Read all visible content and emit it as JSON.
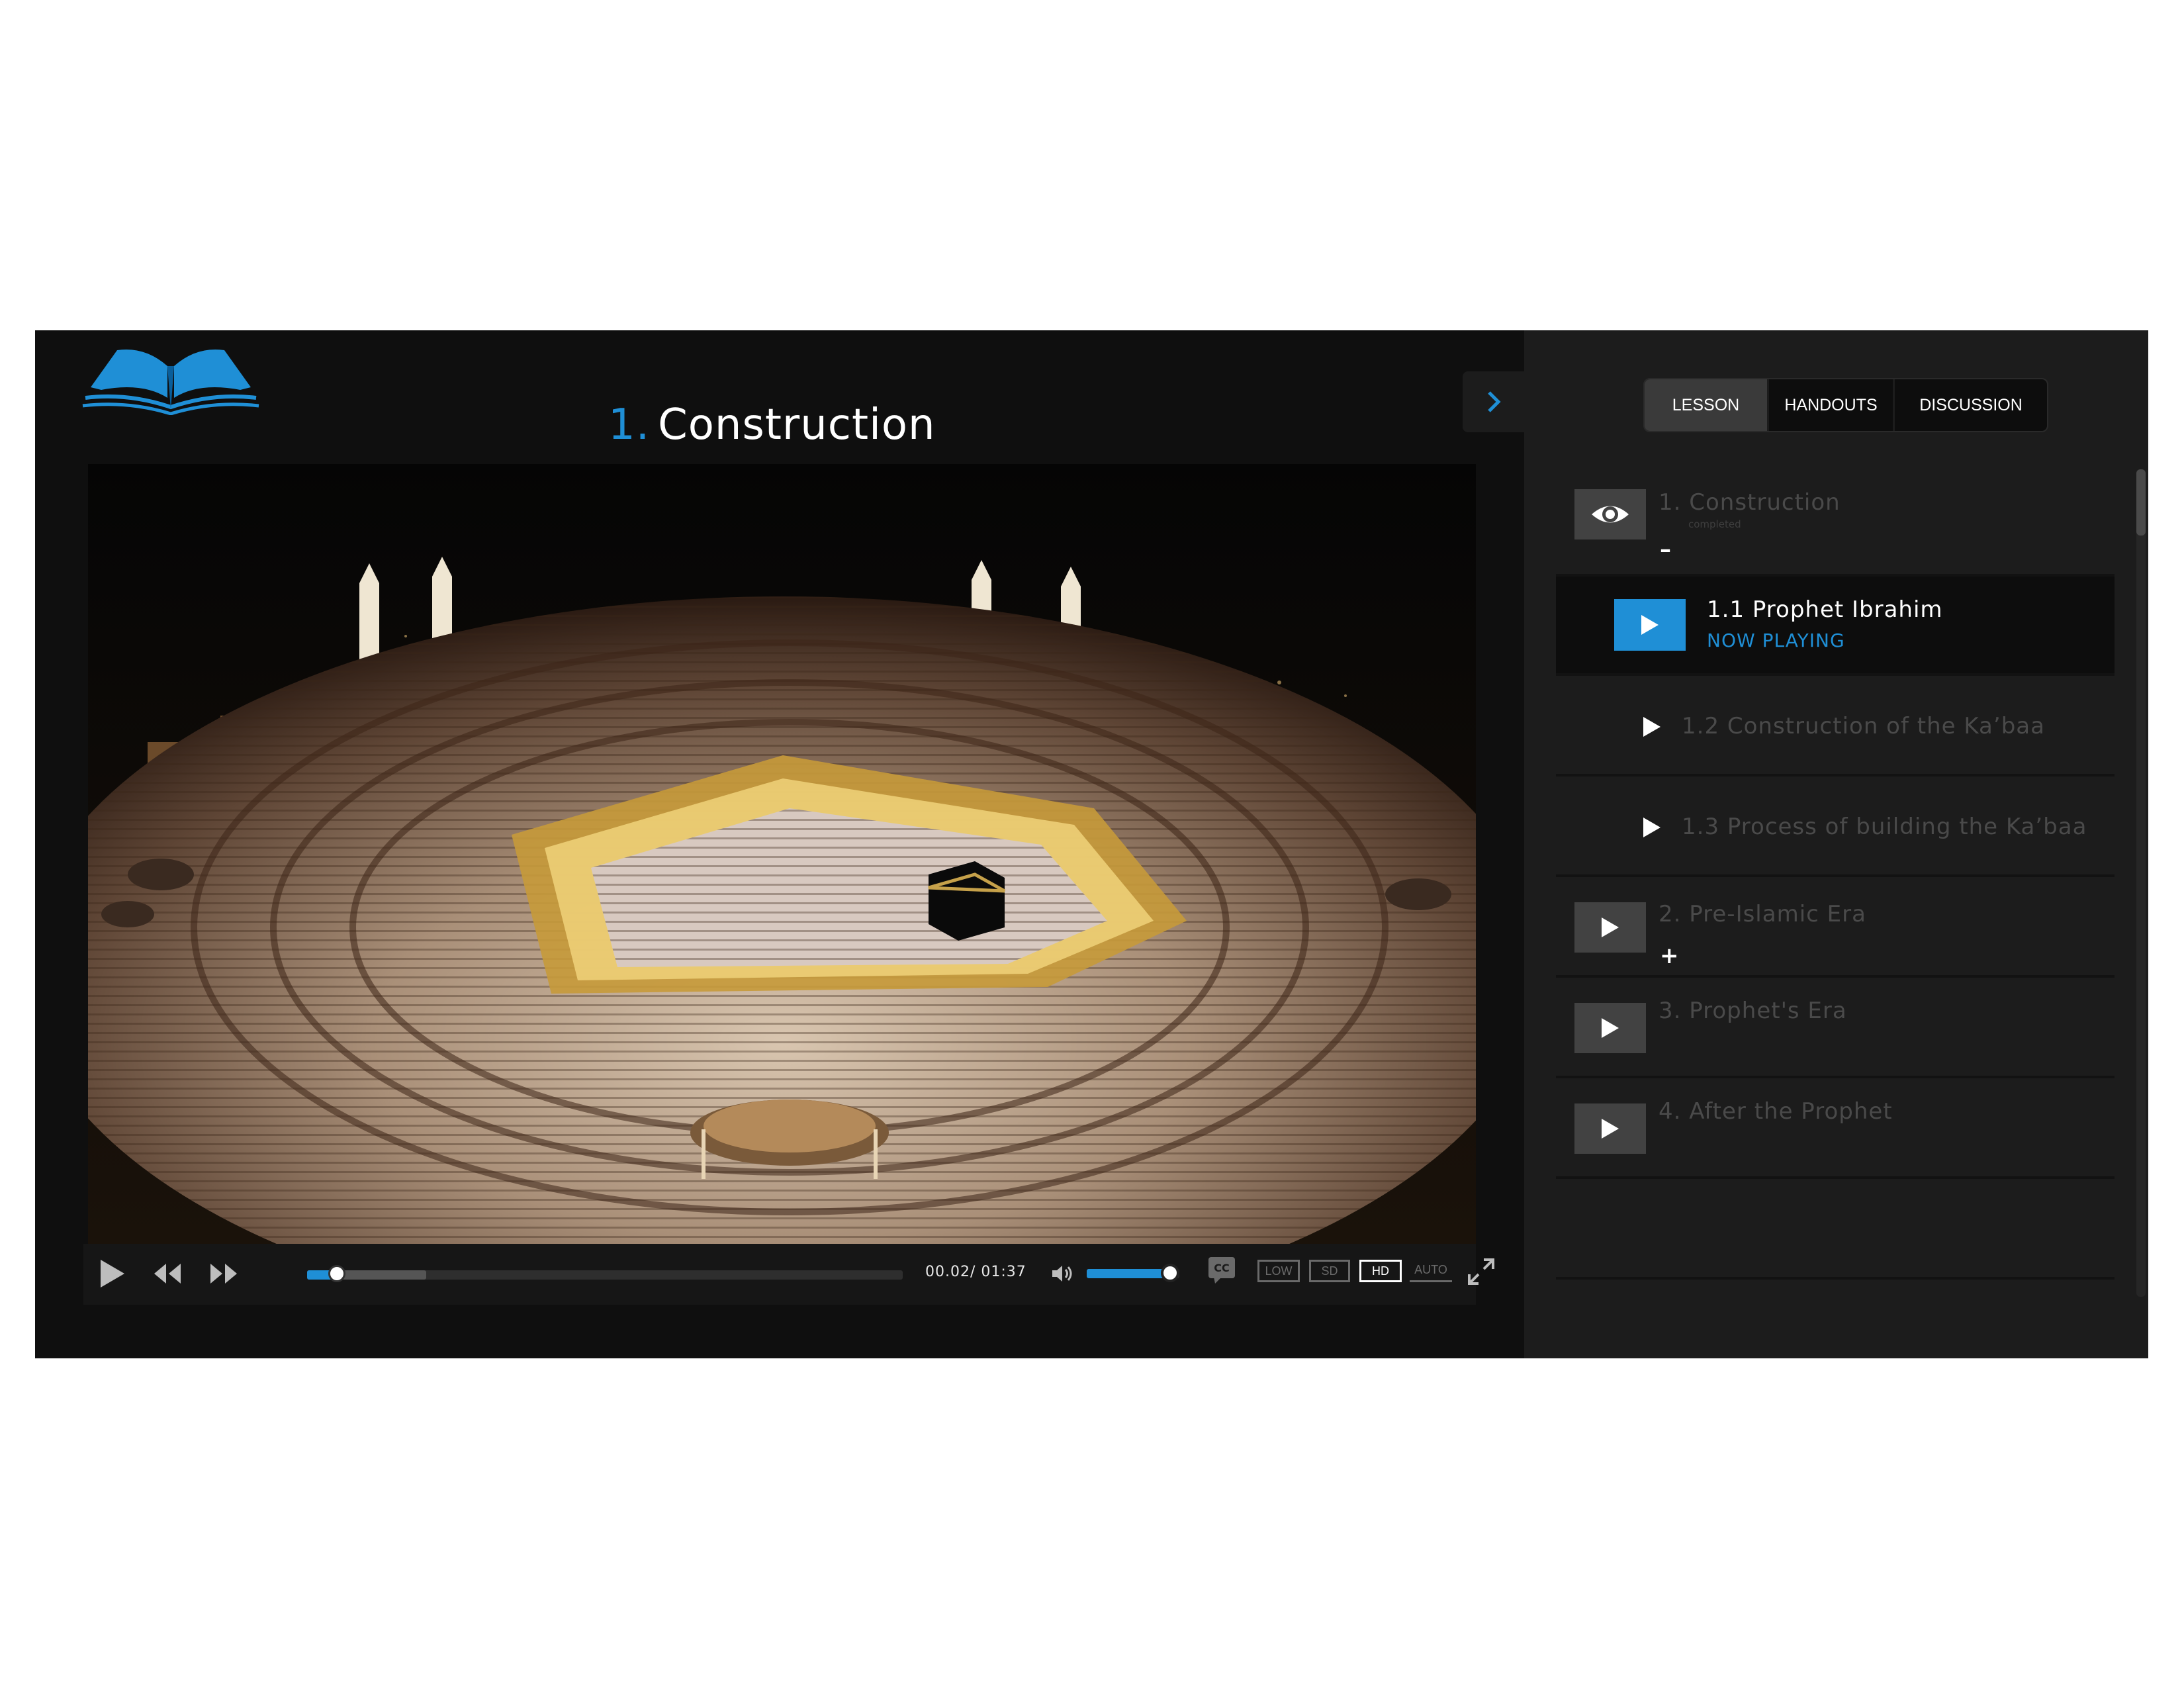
{
  "lesson": {
    "number": "1.",
    "title": "Construction"
  },
  "player": {
    "time": "00.02/ 01:37",
    "progress_fraction": 0.05,
    "buffered_fraction": 0.2,
    "volume_fraction": 0.9,
    "cc_label": "CC",
    "quality_options": [
      "LOW",
      "SD",
      "HD",
      "AUTO"
    ],
    "selected_quality": "HD",
    "scene": "Aerial night view of the Kaaba surrounded by crowds"
  },
  "tabs": [
    {
      "label": "LESSON",
      "selected": true
    },
    {
      "label": "HANDOUTS",
      "selected": false
    },
    {
      "label": "DISCUSSION",
      "selected": false
    }
  ],
  "sections": [
    {
      "label": "1. Construction",
      "status": "completed",
      "toggle": "–",
      "icon": "eye-icon"
    },
    {
      "label": "2. Pre-Islamic Era",
      "toggle": "+",
      "icon": "play-icon"
    },
    {
      "label": "3. Prophet's Era",
      "icon": "play-icon"
    },
    {
      "label": "4. After the Prophet",
      "icon": "play-icon"
    }
  ],
  "subitems": [
    {
      "label": "1.1 Prophet Ibrahim",
      "status": "NOW PLAYING"
    },
    {
      "label": "1.2 Construction of the Ka’baa"
    },
    {
      "label": "1.3 Process of building the Ka’baa"
    }
  ],
  "colors": {
    "accent": "#1f8fd6",
    "panel": "#1c1c1c",
    "background": "#0f0f0f"
  }
}
